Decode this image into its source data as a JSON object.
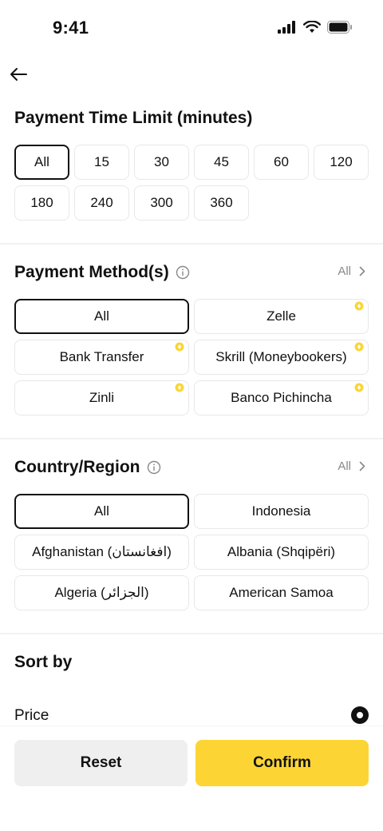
{
  "status": {
    "time": "9:41"
  },
  "icons": {
    "back": "arrow-left-icon",
    "info": "info-icon",
    "chevron": "chevron-right-icon",
    "promo": "promo-badge-icon"
  },
  "colors": {
    "accent": "#fcd535",
    "selected_border": "#111111",
    "muted_text": "#888888"
  },
  "time_limit": {
    "title": "Payment Time Limit (minutes)",
    "options": [
      "All",
      "15",
      "30",
      "45",
      "60",
      "120",
      "180",
      "240",
      "300",
      "360"
    ],
    "selected": "All"
  },
  "payment_methods": {
    "title": "Payment Method(s)",
    "see_all": "All",
    "options": [
      "All",
      "Zelle",
      "Bank Transfer",
      "Skrill (Moneybookers)",
      "Zinli",
      "Banco Pichincha"
    ],
    "selected": "All"
  },
  "country": {
    "title": "Country/Region",
    "see_all": "All",
    "options": [
      "All",
      "Indonesia",
      "Afghanistan (افغانستان)",
      "Albania (Shqipëri)",
      "Algeria (الجزائر)",
      "American Samoa"
    ],
    "selected": "All"
  },
  "sort": {
    "title": "Sort by",
    "option": "Price"
  },
  "footer": {
    "reset": "Reset",
    "confirm": "Confirm"
  }
}
